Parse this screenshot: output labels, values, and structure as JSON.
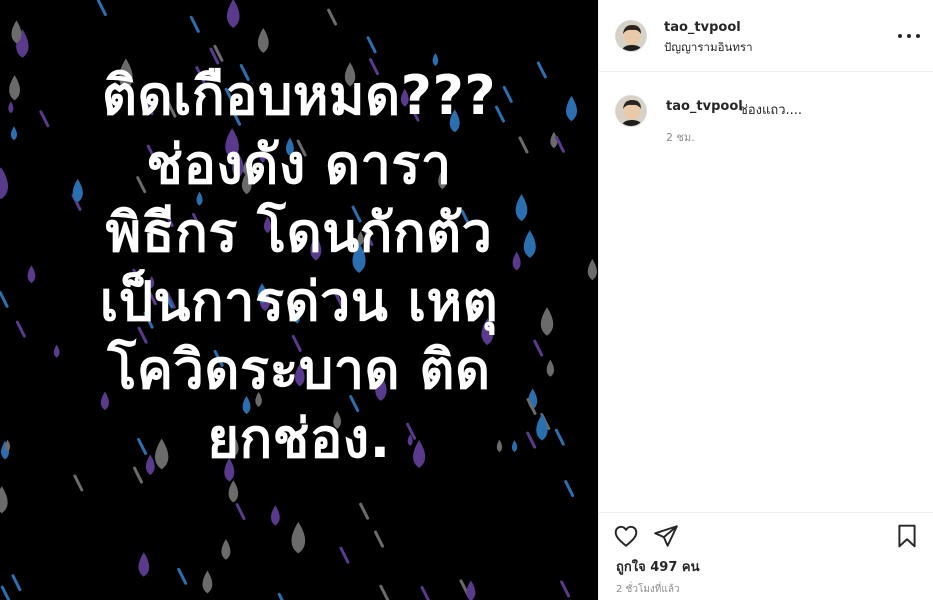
{
  "post": {
    "text_lines": [
      "ติดเกือบหมด???",
      "ช่องดัง ดารา",
      "พิธีกร โดนกักตัว",
      "เป็นการด่วน เหตุ",
      "โควิดระบาด ติด",
      "ยกช่อง."
    ],
    "background_color": "#000000",
    "drop_colors": [
      "#5a3a8c",
      "#2a6fb0",
      "#6b6b6b"
    ]
  },
  "header": {
    "username": "tao_tvpool",
    "location": "ปัญญารามอินทรา",
    "more_icon": "more-horizontal-icon"
  },
  "caption": {
    "username": "tao_tvpool",
    "text": "ช่องแถว....",
    "time_ago": "2 ชม."
  },
  "actions": {
    "like_icon": "heart-icon",
    "share_icon": "paper-plane-icon",
    "save_icon": "bookmark-icon"
  },
  "likes": {
    "text": "ถูกใจ 497 คน"
  },
  "post_time": "2 ชั่วโมงที่แล้ว"
}
